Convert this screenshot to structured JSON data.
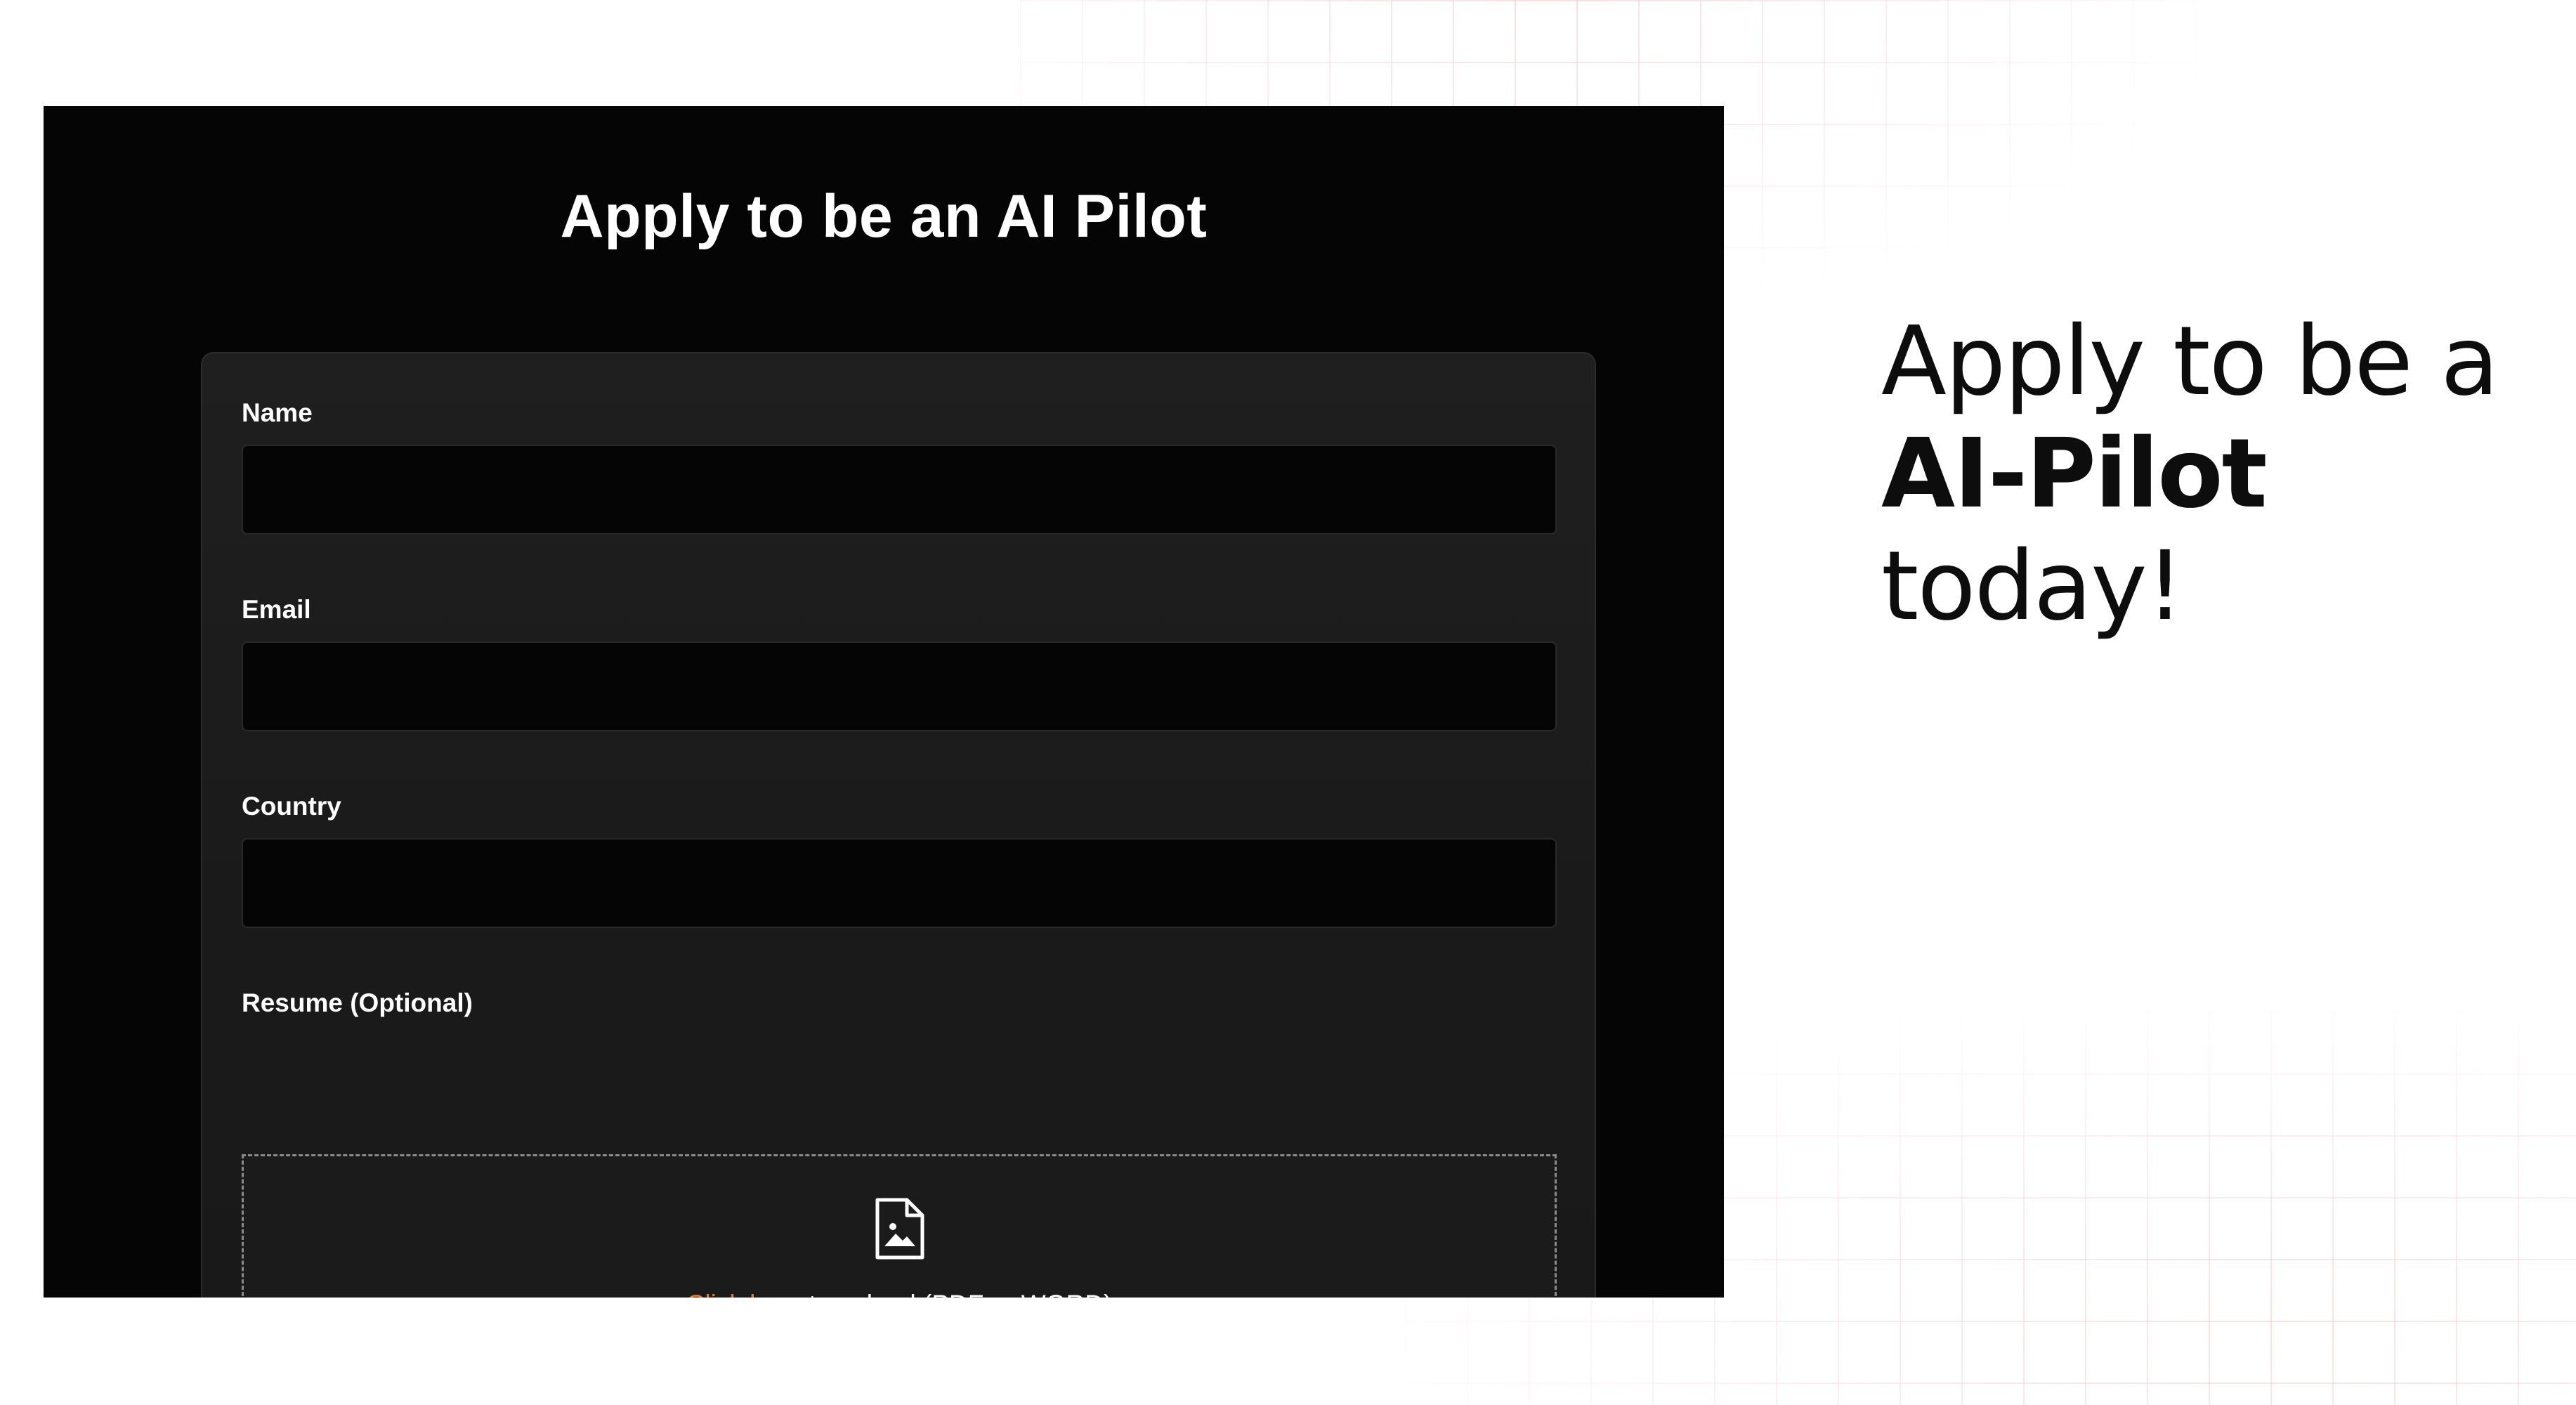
{
  "form": {
    "title": "Apply to be an AI Pilot",
    "fields": [
      {
        "label": "Name",
        "value": "",
        "placeholder": ""
      },
      {
        "label": "Email",
        "value": "",
        "placeholder": ""
      },
      {
        "label": "Country",
        "value": "",
        "placeholder": ""
      }
    ],
    "resume": {
      "label": "Resume (Optional)",
      "icon": "file-image-icon",
      "link_text": "Click here",
      "rest_text": " to upload (PDF or WORD)"
    }
  },
  "hero": {
    "line1": "Apply to be a",
    "line2": "AI-Pilot",
    "line3": "today!"
  },
  "colors": {
    "panel_bg": "#050505",
    "card_bg": "#1f1f1f",
    "link": "#e8782f",
    "hero_text": "#0d0d0d"
  }
}
